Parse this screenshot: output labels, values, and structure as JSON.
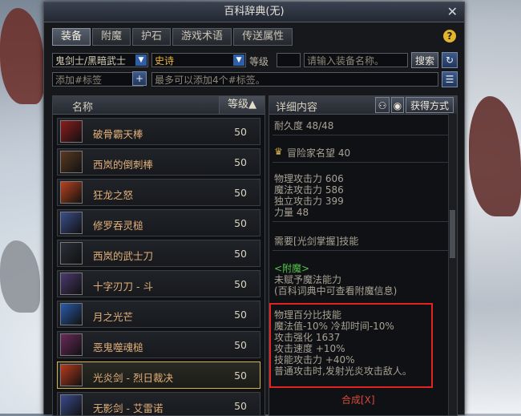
{
  "window": {
    "title": "百科辞典(无)"
  },
  "tabs": [
    {
      "label": "装备"
    },
    {
      "label": "附魔"
    },
    {
      "label": "护石"
    },
    {
      "label": "游戏术语"
    },
    {
      "label": "传送属性"
    }
  ],
  "filters": {
    "class_value": "鬼剑士/黑暗武士",
    "rarity_value": "史诗",
    "level_label": "等级",
    "search_placeholder": "请输入装备名称。",
    "search_button": "搜索",
    "tag_placeholder": "添加#标签",
    "tag_hint": "最多可以添加4个#标签。"
  },
  "list": {
    "header_name": "名称",
    "header_level": "等级▲",
    "items": [
      {
        "name": "破骨霸天棒",
        "level": "50",
        "color": "#8b1d1d"
      },
      {
        "name": "西岚的倒刺棒",
        "level": "50",
        "color": "#5a3a22"
      },
      {
        "name": "狂龙之怒",
        "level": "50",
        "color": "#b8421e"
      },
      {
        "name": "修罗吞灵槌",
        "level": "50",
        "color": "#3a4f8c"
      },
      {
        "name": "西岚的武士刀",
        "level": "50",
        "color": "#2c2f3a"
      },
      {
        "name": "十字刃刀 - 斗",
        "level": "50",
        "color": "#4a3a6e"
      },
      {
        "name": "月之光芒",
        "level": "50",
        "color": "#2a5aa8"
      },
      {
        "name": "恶鬼噬魂槌",
        "level": "50",
        "color": "#6a2a5a"
      },
      {
        "name": "光炎剑 - 烈日裁决",
        "level": "50",
        "color": "#b83a1e"
      },
      {
        "name": "无影剑 - 艾雷诺",
        "level": "50",
        "color": "#3a4a8c"
      }
    ]
  },
  "detail": {
    "header": "详细内容",
    "acquire_button": "获得方式",
    "durability": "耐久度 48/48",
    "fame": "冒险家名望 40",
    "stats": [
      "物理攻击力 606",
      "魔法攻击力 586",
      "独立攻击力 399",
      "力量 48"
    ],
    "requirement": "需要[光剑掌握]技能",
    "enchant_title": "<附魔>",
    "enchant_lines": [
      "未赋予魔法能力",
      "(百科词典中可查看附魔信息)"
    ],
    "effect_lines": [
      "物理百分比技能",
      " 魔法值-10% 冷却时间-10%",
      "攻击强化 1637",
      "攻击速度 +10%",
      "技能攻击力 +40%",
      "普通攻击时,发射光炎攻击敌人。"
    ],
    "craft_link": "合成[X]"
  }
}
